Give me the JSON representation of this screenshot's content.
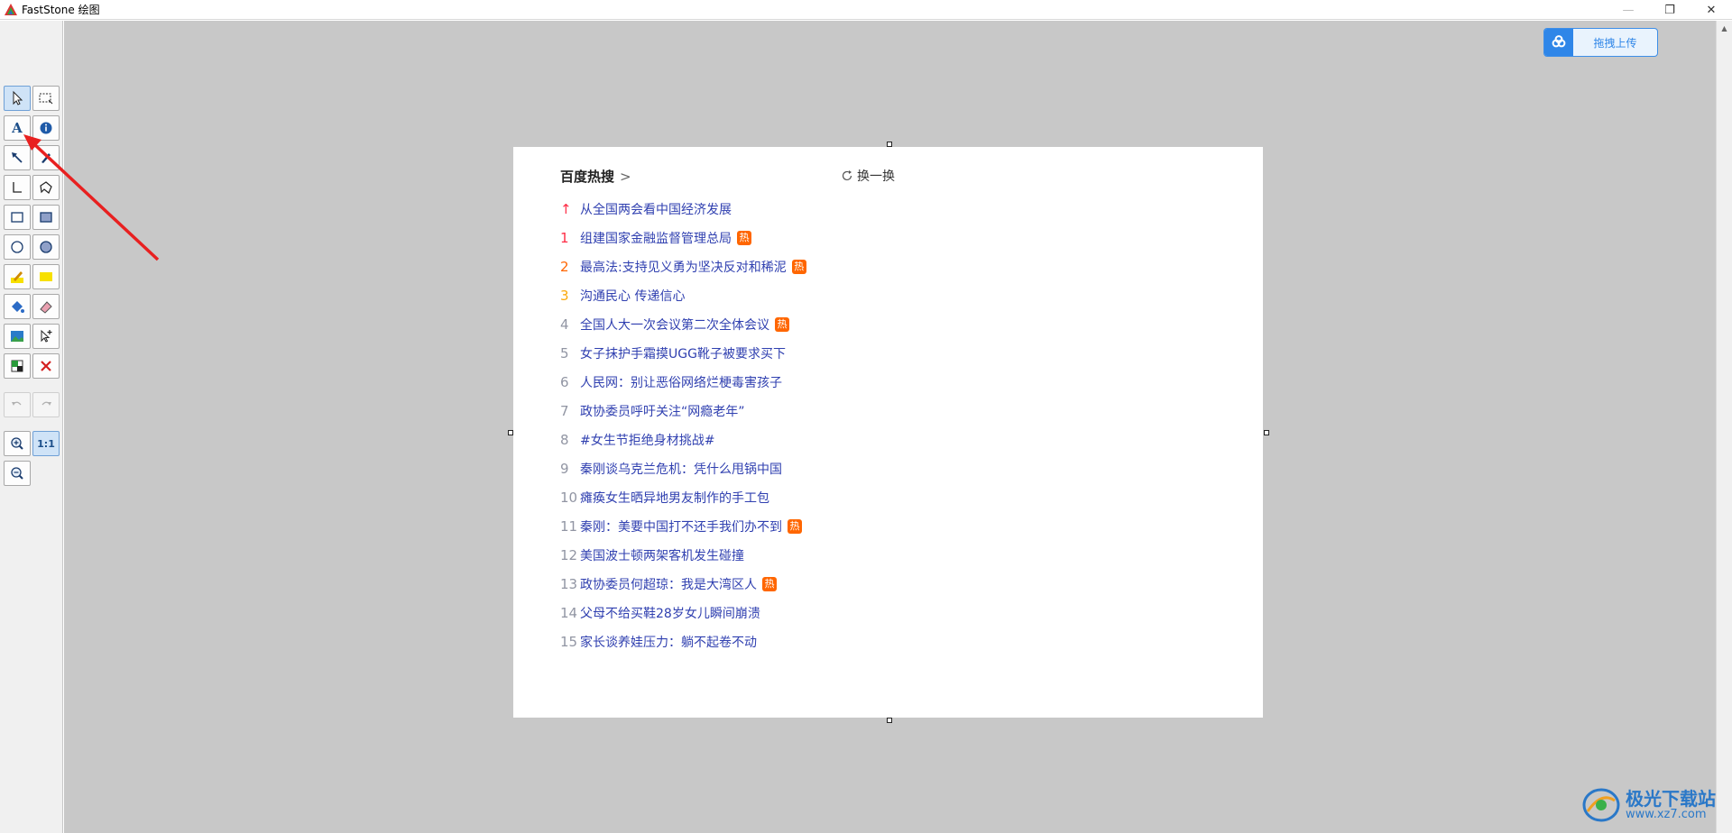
{
  "window": {
    "title": "FastStone 绘图",
    "minimize_glyph": "—",
    "restore_glyph": "❐",
    "close_glyph": "✕"
  },
  "toolbar": {
    "tools": [
      {
        "name": "select-tool",
        "icon": "pointer-icon",
        "active": true
      },
      {
        "name": "rect-select-tool",
        "icon": "rect-select-icon"
      },
      {
        "name": "text-tool",
        "icon": "text-icon",
        "label": "A"
      },
      {
        "name": "step-number-tool",
        "icon": "info-circle-icon"
      },
      {
        "name": "arrow-tool",
        "icon": "arrow-icon"
      },
      {
        "name": "pen-tool",
        "icon": "pen-icon"
      },
      {
        "name": "line-tool",
        "icon": "angle-line-icon"
      },
      {
        "name": "polygon-tool",
        "icon": "polygon-icon"
      },
      {
        "name": "rectangle-tool",
        "icon": "rectangle-icon"
      },
      {
        "name": "filled-rectangle-tool",
        "icon": "filled-rectangle-icon"
      },
      {
        "name": "ellipse-tool",
        "icon": "ellipse-icon"
      },
      {
        "name": "filled-ellipse-tool",
        "icon": "filled-ellipse-icon"
      },
      {
        "name": "highlighter-tool",
        "icon": "highlighter-icon"
      },
      {
        "name": "highlight-rect-tool",
        "icon": "yellow-rect-icon"
      },
      {
        "name": "fill-tool",
        "icon": "paint-bucket-icon"
      },
      {
        "name": "eraser-tool",
        "icon": "eraser-icon"
      },
      {
        "name": "insert-image-tool",
        "icon": "image-icon"
      },
      {
        "name": "insert-cursor-tool",
        "icon": "cursor-plus-icon"
      },
      {
        "name": "color-tool",
        "icon": "color-swatch-icon"
      },
      {
        "name": "delete-tool",
        "icon": "red-x-icon"
      },
      {
        "name": "undo-button",
        "icon": "undo-icon",
        "disabled": true
      },
      {
        "name": "redo-button",
        "icon": "redo-icon",
        "disabled": true
      },
      {
        "name": "zoom-in-button",
        "icon": "zoom-in-icon"
      },
      {
        "name": "actual-size-button",
        "icon": "actual-size-icon",
        "label": "1:1"
      },
      {
        "name": "zoom-out-button",
        "icon": "zoom-out-icon"
      }
    ]
  },
  "upload": {
    "label": "拖拽上传",
    "icon": "baidu-cloud-icon"
  },
  "hot_search": {
    "title": "百度热搜",
    "chevron": ">",
    "refresh_label": "换一换",
    "hot_badge": "热",
    "items": [
      {
        "rank": "↑",
        "text": "从全国两会看中国经济发展",
        "hot": false
      },
      {
        "rank": "1",
        "text": "组建国家金融监督管理总局",
        "hot": true
      },
      {
        "rank": "2",
        "text": "最高法:支持见义勇为坚决反对和稀泥",
        "hot": true
      },
      {
        "rank": "3",
        "text": "沟通民心 传递信心",
        "hot": false
      },
      {
        "rank": "4",
        "text": "全国人大一次会议第二次全体会议",
        "hot": true
      },
      {
        "rank": "5",
        "text": "女子抹护手霜摸UGG靴子被要求买下",
        "hot": false
      },
      {
        "rank": "6",
        "text": "人民网：别让恶俗网络烂梗毒害孩子",
        "hot": false
      },
      {
        "rank": "7",
        "text": "政协委员呼吁关注“网瘾老年”",
        "hot": false
      },
      {
        "rank": "8",
        "text": "#女生节拒绝身材挑战#",
        "hot": false
      },
      {
        "rank": "9",
        "text": "秦刚谈乌克兰危机：凭什么甩锅中国",
        "hot": false
      },
      {
        "rank": "10",
        "text": "瘫痪女生晒异地男友制作的手工包",
        "hot": false
      },
      {
        "rank": "11",
        "text": "秦刚：美要中国打不还手我们办不到",
        "hot": true
      },
      {
        "rank": "12",
        "text": "美国波士顿两架客机发生碰撞",
        "hot": false
      },
      {
        "rank": "13",
        "text": "政协委员何超琼：我是大湾区人",
        "hot": true
      },
      {
        "rank": "14",
        "text": "父母不给买鞋28岁女儿瞬间崩溃",
        "hot": false
      },
      {
        "rank": "15",
        "text": "家长谈养娃压力：躺不起卷不动",
        "hot": false
      }
    ]
  },
  "watermark": {
    "name": "极光下载站",
    "url": "www.xz7.com"
  },
  "colors": {
    "canvas_bg": "#c8c8c8",
    "annotation_arrow": "#e82020",
    "accent_blue": "#2f86e8",
    "hot_badge": "#ff6600"
  }
}
